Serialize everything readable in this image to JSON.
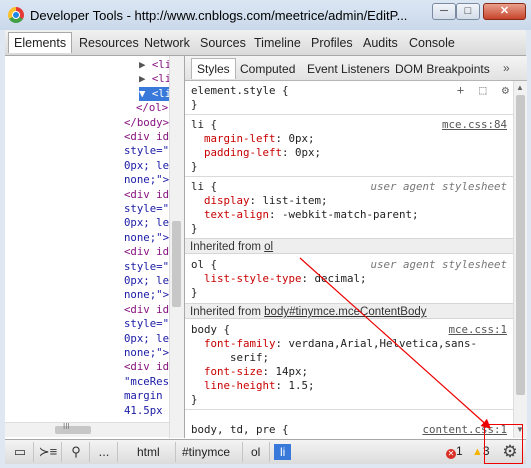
{
  "window": {
    "title": "Developer Tools - http://www.cnblogs.com/meetrice/admin/EditP...",
    "minimize_label": "─",
    "maximize_label": "□",
    "close_label": "✕"
  },
  "main_tabs": [
    "Elements",
    "Resources",
    "Network",
    "Sources",
    "Timeline",
    "Profiles",
    "Audits",
    "Console"
  ],
  "tree": {
    "lines": [
      {
        "tri": "▶",
        "text": "<li"
      },
      {
        "tri": "▶",
        "text": "<li"
      },
      {
        "tri": "▼",
        "text": "<li"
      },
      {
        "tri": "",
        "text": "</ol>"
      },
      {
        "tri": "",
        "text": "</body>"
      },
      {
        "tri": "",
        "text": "<div id"
      },
      {
        "tri": "",
        "text": "style=\""
      },
      {
        "tri": "",
        "text": "0px; le"
      },
      {
        "tri": "",
        "text": "none;\">"
      },
      {
        "tri": "",
        "text": "<div id"
      },
      {
        "tri": "",
        "text": "style=\""
      },
      {
        "tri": "",
        "text": "0px; le"
      },
      {
        "tri": "",
        "text": "none;\">"
      },
      {
        "tri": "",
        "text": "<div id"
      },
      {
        "tri": "",
        "text": "style=\""
      },
      {
        "tri": "",
        "text": "0px; le"
      },
      {
        "tri": "",
        "text": "none;\">"
      },
      {
        "tri": "",
        "text": "<div id"
      },
      {
        "tri": "",
        "text": "style=\""
      },
      {
        "tri": "",
        "text": "0px; le"
      },
      {
        "tri": "",
        "text": "none;\">"
      },
      {
        "tri": "",
        "text": "<div id"
      },
      {
        "tri": "",
        "text": "\"mceRes"
      },
      {
        "tri": "",
        "text": "margin"
      },
      {
        "tri": "",
        "text": "41.5px"
      }
    ],
    "hscroll_label": "III"
  },
  "side_tabs": [
    "Styles",
    "Computed",
    "Event Listeners",
    "DOM Breakpoints"
  ],
  "side_tabs_more": "»",
  "styles": {
    "element_style": "element.style {",
    "element_style_close": "}",
    "icons": [
      "+",
      "⬚",
      "⚙"
    ],
    "rule1": {
      "selector": "li {",
      "origin": "mce.css:84",
      "props": [
        {
          "name": "margin-left",
          "value": "0px;"
        },
        {
          "name": "padding-left",
          "value": "0px;"
        }
      ],
      "close": "}"
    },
    "rule2": {
      "selector": "li {",
      "origin": "user agent stylesheet",
      "props": [
        {
          "name": "display",
          "value": "list-item;"
        },
        {
          "name": "text-align",
          "value": "-webkit-match-parent;"
        }
      ],
      "close": "}"
    },
    "inherited1": {
      "prefix": "Inherited from",
      "target": "ol"
    },
    "rule3": {
      "selector": "ol {",
      "origin": "user agent stylesheet",
      "props": [
        {
          "name": "list-style-type",
          "value": "decimal;"
        }
      ],
      "close": "}"
    },
    "inherited2": {
      "prefix": "Inherited from",
      "target": "body#tinymce.mceContentBody"
    },
    "rule4": {
      "selector": "body {",
      "origin": "mce.css:1",
      "props": [
        {
          "name": "font-family",
          "value": "verdana,Arial,Helvetica,sans-"
        },
        {
          "name": "",
          "value": "serif;"
        },
        {
          "name": "font-size",
          "value": "14px;"
        },
        {
          "name": "line-height",
          "value": "1.5;"
        }
      ],
      "close": "}"
    },
    "rule5": {
      "selector": "body, td, pre {",
      "origin": "content.css:1"
    }
  },
  "statusbar": {
    "dock_icon": "dock-icon",
    "console_icon": "console-icon",
    "search_icon": "search-icon",
    "ellipsis": "...",
    "crumbs": [
      "html",
      "#tinymce",
      "ol",
      "li"
    ],
    "errors": "1",
    "warnings": "3",
    "error_glyph": "✕",
    "warning_glyph": "▲"
  },
  "colors": {
    "selection": "#3879d9",
    "annotation": "#e00000",
    "property_name": "#c80000",
    "tag": "#881280"
  }
}
